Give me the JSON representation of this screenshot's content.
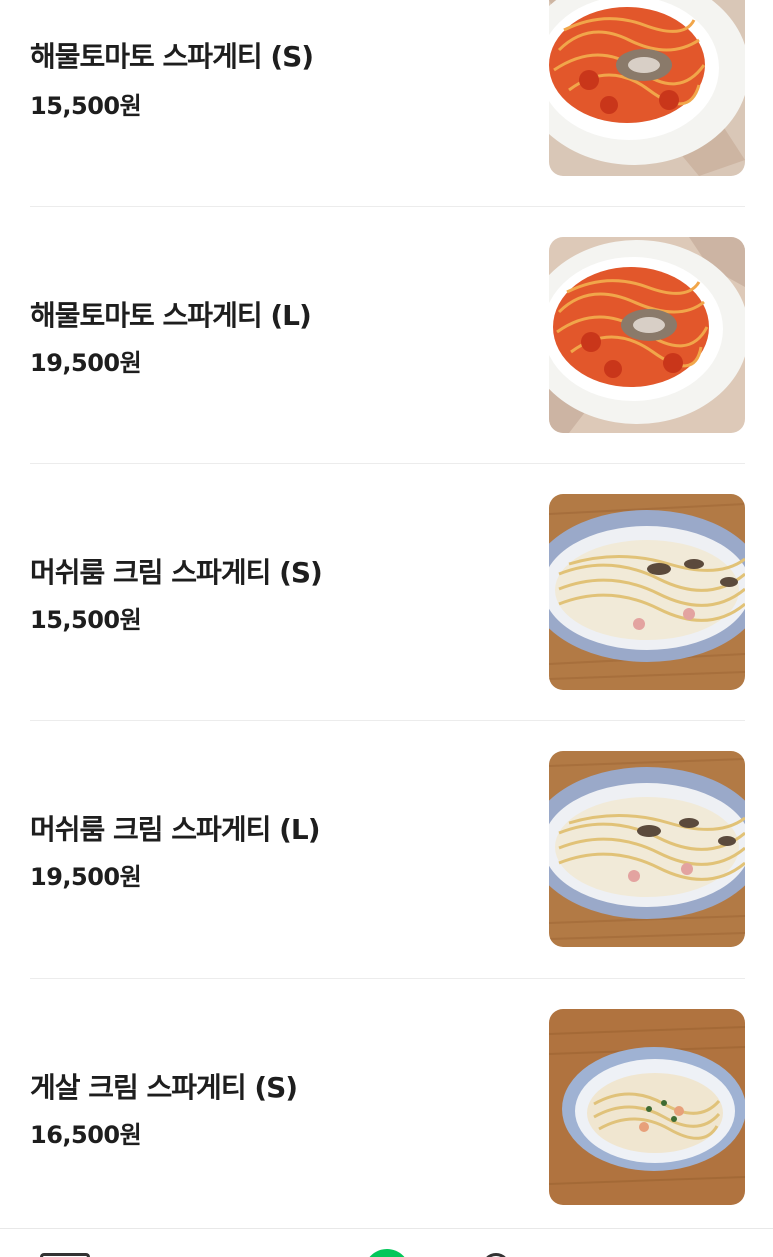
{
  "menu": {
    "items": [
      {
        "name": "해물토마토 스파게티 (S)",
        "price": "15,500원",
        "photo": "tomato-seafood-spaghetti-photo"
      },
      {
        "name": "해물토마토 스파게티 (L)",
        "price": "19,500원",
        "photo": "tomato-seafood-spaghetti-photo"
      },
      {
        "name": "머쉬룸 크림 스파게티 (S)",
        "price": "15,500원",
        "photo": "mushroom-cream-spaghetti-photo"
      },
      {
        "name": "머쉬룸 크림 스파게티 (L)",
        "price": "19,500원",
        "photo": "mushroom-cream-spaghetti-photo"
      },
      {
        "name": "게살 크림 스파게티 (S)",
        "price": "16,500원",
        "photo": "crab-cream-spaghetti-photo"
      }
    ]
  },
  "tabbar": {
    "icons": [
      "list-icon",
      "home-icon",
      "profile-icon"
    ],
    "accent": "#03c75a"
  }
}
